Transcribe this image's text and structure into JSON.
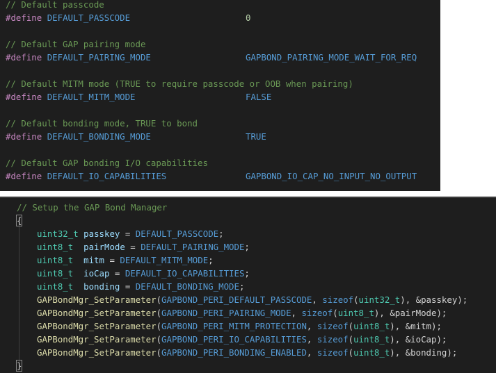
{
  "defines": [
    {
      "comment": "// Default passcode",
      "keyword": "#define",
      "name": "DEFAULT_PASSCODE",
      "value": "0",
      "value_type": "number"
    },
    {
      "comment": "// Default GAP pairing mode",
      "keyword": "#define",
      "name": "DEFAULT_PAIRING_MODE",
      "value": "GAPBOND_PAIRING_MODE_WAIT_FOR_REQ",
      "value_type": "macro"
    },
    {
      "comment": "// Default MITM mode (TRUE to require passcode or OOB when pairing)",
      "keyword": "#define",
      "name": "DEFAULT_MITM_MODE",
      "value": "FALSE",
      "value_type": "macro"
    },
    {
      "comment": "// Default bonding mode, TRUE to bond",
      "keyword": "#define",
      "name": "DEFAULT_BONDING_MODE",
      "value": "TRUE",
      "value_type": "macro"
    },
    {
      "comment": "// Default GAP bonding I/O capabilities",
      "keyword": "#define",
      "name": "DEFAULT_IO_CAPABILITIES",
      "value": "GAPBOND_IO_CAP_NO_INPUT_NO_OUTPUT",
      "value_type": "macro"
    }
  ],
  "setup": {
    "comment": "// Setup the GAP Bond Manager",
    "open_brace": "{",
    "close_brace": "}",
    "declarations": [
      {
        "type": "uint32_t",
        "name": "passkey",
        "value": "DEFAULT_PASSCODE"
      },
      {
        "type": "uint8_t",
        "name": "pairMode",
        "value": "DEFAULT_PAIRING_MODE"
      },
      {
        "type": "uint8_t",
        "name": "mitm",
        "value": "DEFAULT_MITM_MODE"
      },
      {
        "type": "uint8_t",
        "name": "ioCap",
        "value": "DEFAULT_IO_CAPABILITIES"
      },
      {
        "type": "uint8_t",
        "name": "bonding",
        "value": "DEFAULT_BONDING_MODE"
      }
    ],
    "calls": [
      {
        "func": "GAPBondMgr_SetParameter",
        "param": "GAPBOND_PERI_DEFAULT_PASSCODE",
        "sizeof": "sizeof",
        "size_type": "uint32_t",
        "ref": "&passkey"
      },
      {
        "func": "GAPBondMgr_SetParameter",
        "param": "GAPBOND_PERI_PAIRING_MODE",
        "sizeof": "sizeof",
        "size_type": "uint8_t",
        "ref": "&pairMode"
      },
      {
        "func": "GAPBondMgr_SetParameter",
        "param": "GAPBOND_PERI_MITM_PROTECTION",
        "sizeof": "sizeof",
        "size_type": "uint8_t",
        "ref": "&mitm"
      },
      {
        "func": "GAPBondMgr_SetParameter",
        "param": "GAPBOND_PERI_IO_CAPABILITIES",
        "sizeof": "sizeof",
        "size_type": "uint8_t",
        "ref": "&ioCap"
      },
      {
        "func": "GAPBondMgr_SetParameter",
        "param": "GAPBOND_PERI_BONDING_ENABLED",
        "sizeof": "sizeof",
        "size_type": "uint8_t",
        "ref": "&bonding"
      }
    ]
  }
}
